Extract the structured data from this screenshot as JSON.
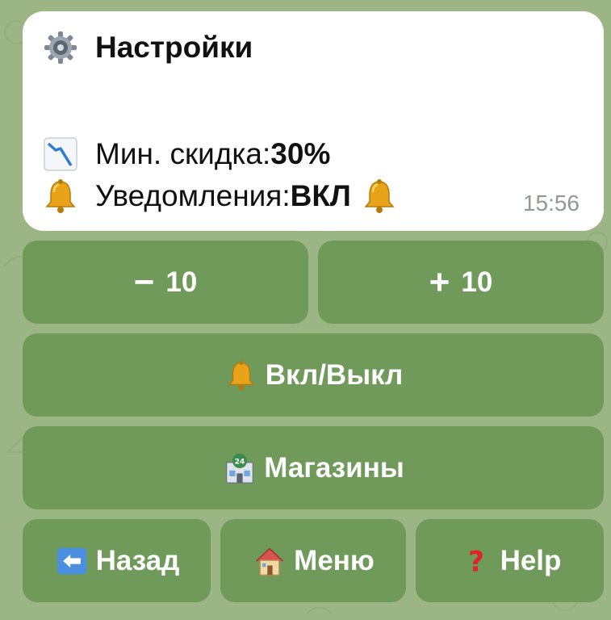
{
  "message": {
    "title": "Настройки",
    "title_icon": "gear-icon",
    "discount_label": "Мин. скидка: ",
    "discount_value": "30%",
    "discount_icon": "chart-decreasing-icon",
    "notifications_label": "Уведомления: ",
    "notifications_value": "ВКЛ",
    "notifications_icon": "bell-icon",
    "time": "15:56"
  },
  "keyboard": {
    "minus_symbol": "−",
    "minus_label": "10",
    "plus_symbol": "+",
    "plus_label": "10",
    "toggle_label": "Вкл/Выкл",
    "stores_label": "Магазины",
    "back_label": "Назад",
    "menu_label": "Меню",
    "help_label": "Help"
  },
  "colors": {
    "background": "#9cb584",
    "button": "#6f9a5a",
    "bubble": "#ffffff"
  }
}
